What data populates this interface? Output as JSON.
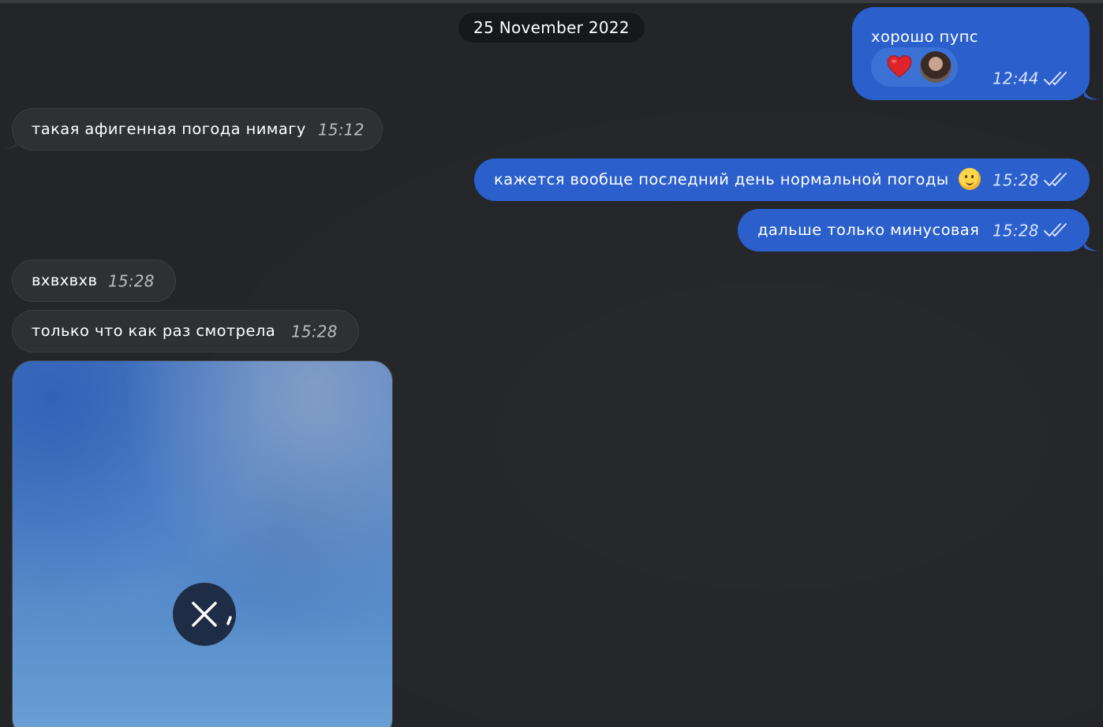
{
  "date_separator": "25 November 2022",
  "messages": [
    {
      "direction": "out",
      "text": "хорошо пупс",
      "time": "12:44",
      "status": "read-double-check",
      "reaction": {
        "emoji": "❤️",
        "icon": "heart-icon"
      }
    },
    {
      "direction": "in",
      "text": "такая афигенная погода нимагу",
      "time": "15:12"
    },
    {
      "direction": "out",
      "text": "кажется вообще последний день нормальной погоды",
      "emoji": "🫠",
      "time": "15:28",
      "status": "read-double-check"
    },
    {
      "direction": "out",
      "text": "дальше только минусовая",
      "time": "15:28",
      "status": "read-double-check"
    },
    {
      "direction": "in",
      "text": "вхвхвхв",
      "time": "15:28"
    },
    {
      "direction": "in",
      "text": "только что как раз смотрела",
      "time": "15:28"
    },
    {
      "direction": "in",
      "type": "photo",
      "state": "uploading",
      "icon": "close-icon"
    }
  ],
  "colors": {
    "background": "#232528",
    "outgoing_bubble": "#2a5fcc",
    "incoming_bubble": "#2e3033",
    "date_pill": "#16181a"
  }
}
